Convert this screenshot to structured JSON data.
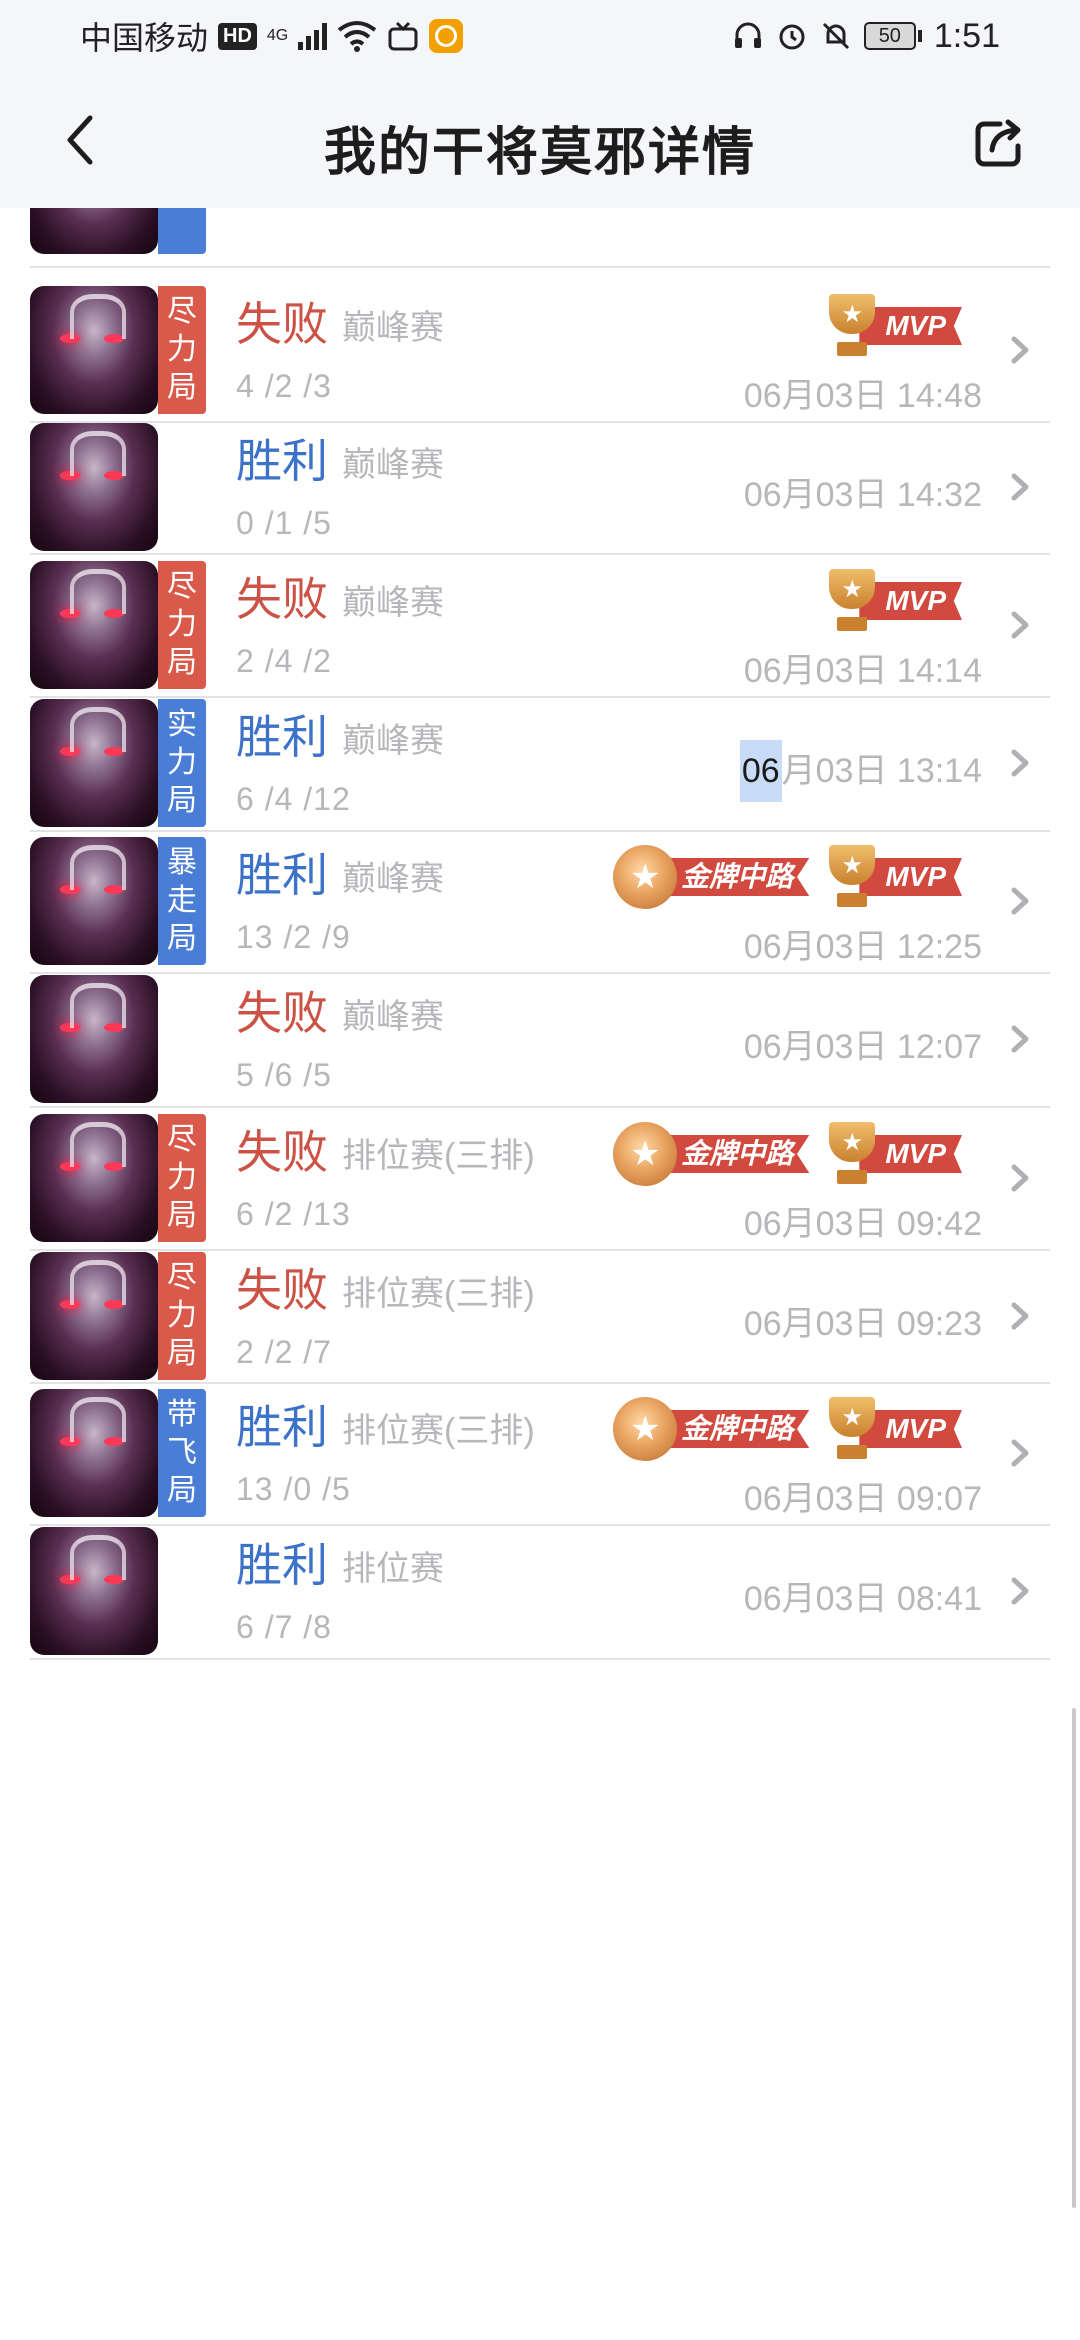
{
  "status_bar": {
    "carrier": "中国移动",
    "hd": "HD",
    "network": "4G",
    "battery": "50",
    "time": "1:51"
  },
  "header": {
    "title": "我的干将莫邪详情",
    "back_icon": "chevron-left-icon",
    "share_icon": "share-icon"
  },
  "matches": [
    {
      "result": "失败",
      "result_type": "loss",
      "mode": "巅峰赛",
      "kda": "4 /2 /3",
      "time": "06月03日 14:48",
      "tag": [
        "尽",
        "力",
        "局"
      ],
      "tag_color": "red",
      "badges": [
        "MVP"
      ]
    },
    {
      "result": "胜利",
      "result_type": "win",
      "mode": "巅峰赛",
      "kda": "0 /1 /5",
      "time": "06月03日 14:32",
      "tag": [],
      "tag_color": "",
      "badges": []
    },
    {
      "result": "失败",
      "result_type": "loss",
      "mode": "巅峰赛",
      "kda": "2 /4 /2",
      "time": "06月03日 14:14",
      "tag": [
        "尽",
        "力",
        "局"
      ],
      "tag_color": "red",
      "badges": [
        "MVP"
      ]
    },
    {
      "result": "胜利",
      "result_type": "win",
      "mode": "巅峰赛",
      "kda": "6 /4 /12",
      "time_sel": "06",
      "time_rest": "月03日 13:14",
      "tag": [
        "实",
        "力",
        "局"
      ],
      "tag_color": "blue",
      "badges": []
    },
    {
      "result": "胜利",
      "result_type": "win",
      "mode": "巅峰赛",
      "kda": "13 /2 /9",
      "time": "06月03日 12:25",
      "tag": [
        "暴",
        "走",
        "局"
      ],
      "tag_color": "blue",
      "badges": [
        "金牌中路",
        "MVP"
      ]
    },
    {
      "result": "失败",
      "result_type": "loss",
      "mode": "巅峰赛",
      "kda": "5 /6 /5",
      "time": "06月03日 12:07",
      "tag": [],
      "tag_color": "",
      "badges": []
    },
    {
      "result": "失败",
      "result_type": "loss",
      "mode": "排位赛(三排)",
      "kda": "6 /2 /13",
      "time": "06月03日 09:42",
      "tag": [
        "尽",
        "力",
        "局"
      ],
      "tag_color": "red",
      "badges": [
        "金牌中路",
        "MVP"
      ]
    },
    {
      "result": "失败",
      "result_type": "loss",
      "mode": "排位赛(三排)",
      "kda": "2 /2 /7",
      "time": "06月03日 09:23",
      "tag": [
        "尽",
        "力",
        "局"
      ],
      "tag_color": "red",
      "badges": []
    },
    {
      "result": "胜利",
      "result_type": "win",
      "mode": "排位赛(三排)",
      "kda": "13 /0 /5",
      "time": "06月03日 09:07",
      "tag": [
        "带",
        "飞",
        "局"
      ],
      "tag_color": "blue",
      "badges": [
        "金牌中路",
        "MVP"
      ]
    },
    {
      "result": "胜利",
      "result_type": "win",
      "mode": "排位赛",
      "kda": "6 /7 /8",
      "time": "06月03日 08:41",
      "tag": [],
      "tag_color": "",
      "badges": []
    }
  ]
}
